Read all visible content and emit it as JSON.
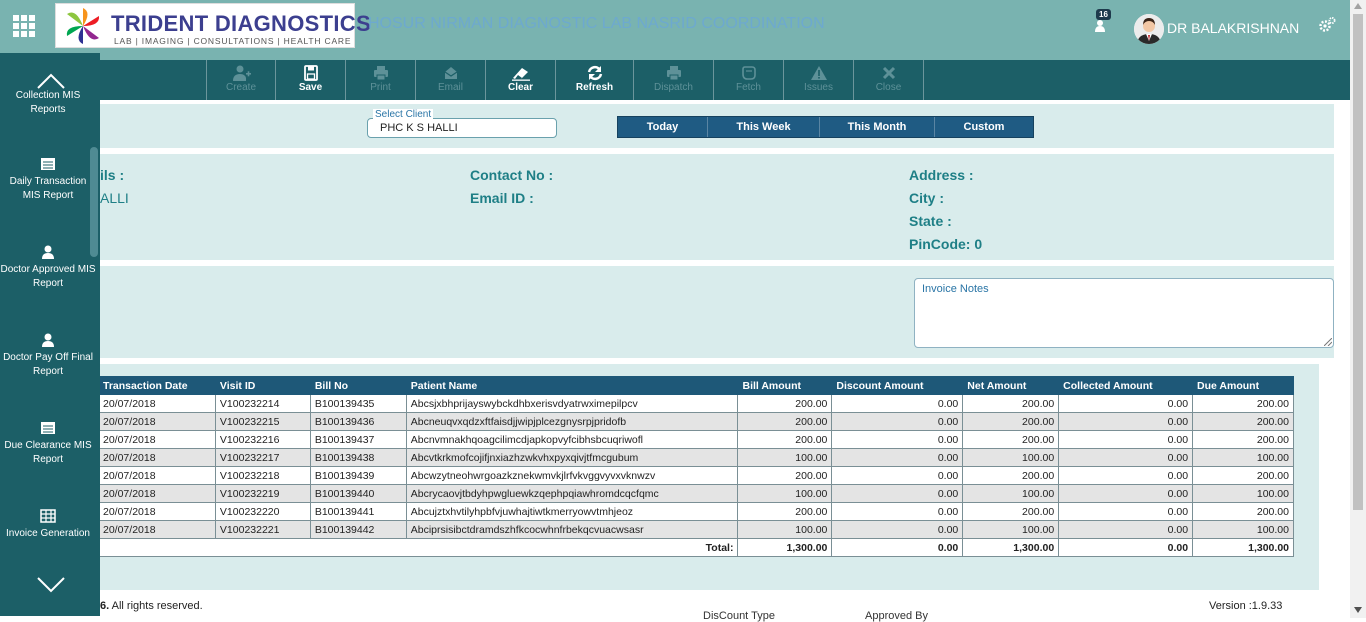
{
  "header": {
    "brand_title": "TRIDENT DIAGNOSTICS",
    "brand_subtitle": "LAB | IMAGING | CONSULTATIONS | HEALTH CARE",
    "hospital_name": "HOSUR NIRMAN DIAGNOSTIC LAB NASRID COORDINATION",
    "notification_count": "16",
    "username": "DR BALAKRISHNAN"
  },
  "toolbar": [
    {
      "label": "Create",
      "icon": "add-user-icon",
      "enabled": false
    },
    {
      "label": "Save",
      "icon": "save-icon",
      "enabled": true
    },
    {
      "label": "Print",
      "icon": "print-icon",
      "enabled": false
    },
    {
      "label": "Email",
      "icon": "email-icon",
      "enabled": false
    },
    {
      "label": "Clear",
      "icon": "eraser-icon",
      "enabled": true
    },
    {
      "label": "Refresh",
      "icon": "refresh-icon",
      "enabled": true
    },
    {
      "label": "Dispatch",
      "icon": "print-icon",
      "enabled": false
    },
    {
      "label": "Fetch",
      "icon": "hand-icon",
      "enabled": false
    },
    {
      "label": "Issues",
      "icon": "warning-icon",
      "enabled": false
    },
    {
      "label": "Close",
      "icon": "close-icon",
      "enabled": false
    }
  ],
  "sidebar": {
    "items": [
      {
        "label": "Collection MIS Reports",
        "icon": "report-icon"
      },
      {
        "label": "Daily Transaction MIS Report",
        "icon": "report-icon"
      },
      {
        "label": "Doctor Approved MIS Report",
        "icon": "user-icon"
      },
      {
        "label": "Doctor Pay Off Final Report",
        "icon": "user-icon"
      },
      {
        "label": "Due Clearance MIS Report",
        "icon": "report-icon"
      },
      {
        "label": "Invoice Generation",
        "icon": "table-icon"
      }
    ]
  },
  "filters": {
    "client_label": "Select Client",
    "client_value": "PHC K S HALLI",
    "date_ranges": [
      "Today",
      "This Week",
      "This Month",
      "Custom"
    ]
  },
  "details": {
    "left_label": "ils :",
    "left_value": "ALLI",
    "contact_label": "Contact No :",
    "email_label": "Email ID :",
    "address_label": "Address :",
    "city_label": "City :",
    "state_label": "State :",
    "pincode_label": "PinCode: 0"
  },
  "invoice_notes_label": "Invoice Notes",
  "table": {
    "columns": [
      "Transaction Date",
      "Visit ID",
      "Bill No",
      "Patient Name",
      "Bill Amount",
      "Discount Amount",
      "Net Amount",
      "Collected Amount",
      "Due Amount"
    ],
    "rows": [
      [
        "20/07/2018",
        "V100232214",
        "B100139435",
        "Abcsjxbhprijayswybckdhbxerisvdyatrwximepilpcv",
        "200.00",
        "0.00",
        "200.00",
        "0.00",
        "200.00"
      ],
      [
        "20/07/2018",
        "V100232215",
        "B100139436",
        "Abcneuqvxqdzxftfaisdjjwipjplcezgnysrpjpridofb",
        "200.00",
        "0.00",
        "200.00",
        "0.00",
        "200.00"
      ],
      [
        "20/07/2018",
        "V100232216",
        "B100139437",
        "Abcnvmnakhqoagcilimcdjapkopvyfcibhsbcuqriwofl",
        "200.00",
        "0.00",
        "200.00",
        "0.00",
        "200.00"
      ],
      [
        "20/07/2018",
        "V100232217",
        "B100139438",
        "Abcvtkrkmofcojifjnxiazhzwkvhxpyxqivjtfmcgubum",
        "100.00",
        "0.00",
        "100.00",
        "0.00",
        "100.00"
      ],
      [
        "20/07/2018",
        "V100232218",
        "B100139439",
        "Abcwzytneohwrgoazkznekwmvkjlrfvkvggvyvxvknwzv",
        "200.00",
        "0.00",
        "200.00",
        "0.00",
        "200.00"
      ],
      [
        "20/07/2018",
        "V100232219",
        "B100139440",
        "Abcrycaovjtbdyhpwgluewkzqephpqiawhromdcqcfqmc",
        "100.00",
        "0.00",
        "100.00",
        "0.00",
        "100.00"
      ],
      [
        "20/07/2018",
        "V100232220",
        "B100139441",
        "Abcujztxhvtilyhpbfvjuwhajtiwtkmerryowvtmhjeoz",
        "200.00",
        "0.00",
        "200.00",
        "0.00",
        "200.00"
      ],
      [
        "20/07/2018",
        "V100232221",
        "B100139442",
        "Abciprsisibctdramdszhfkcocwhnfrbekqcvuacwsasr",
        "100.00",
        "0.00",
        "100.00",
        "0.00",
        "100.00"
      ]
    ],
    "total_label": "Total:",
    "totals": [
      "1,300.00",
      "0.00",
      "1,300.00",
      "0.00",
      "1,300.00"
    ]
  },
  "footer": {
    "copyright": "6. All rights reserved.",
    "version": "Version :1.9.33",
    "discount_type_label": "DisCount Type",
    "approved_by_label": "Approved By"
  },
  "colors": {
    "topbar": "#79b3b0",
    "toolbar": "#1c5f67",
    "panel": "#d9ecec",
    "table_header": "#1e5878",
    "accent_text": "#1e7f86"
  }
}
